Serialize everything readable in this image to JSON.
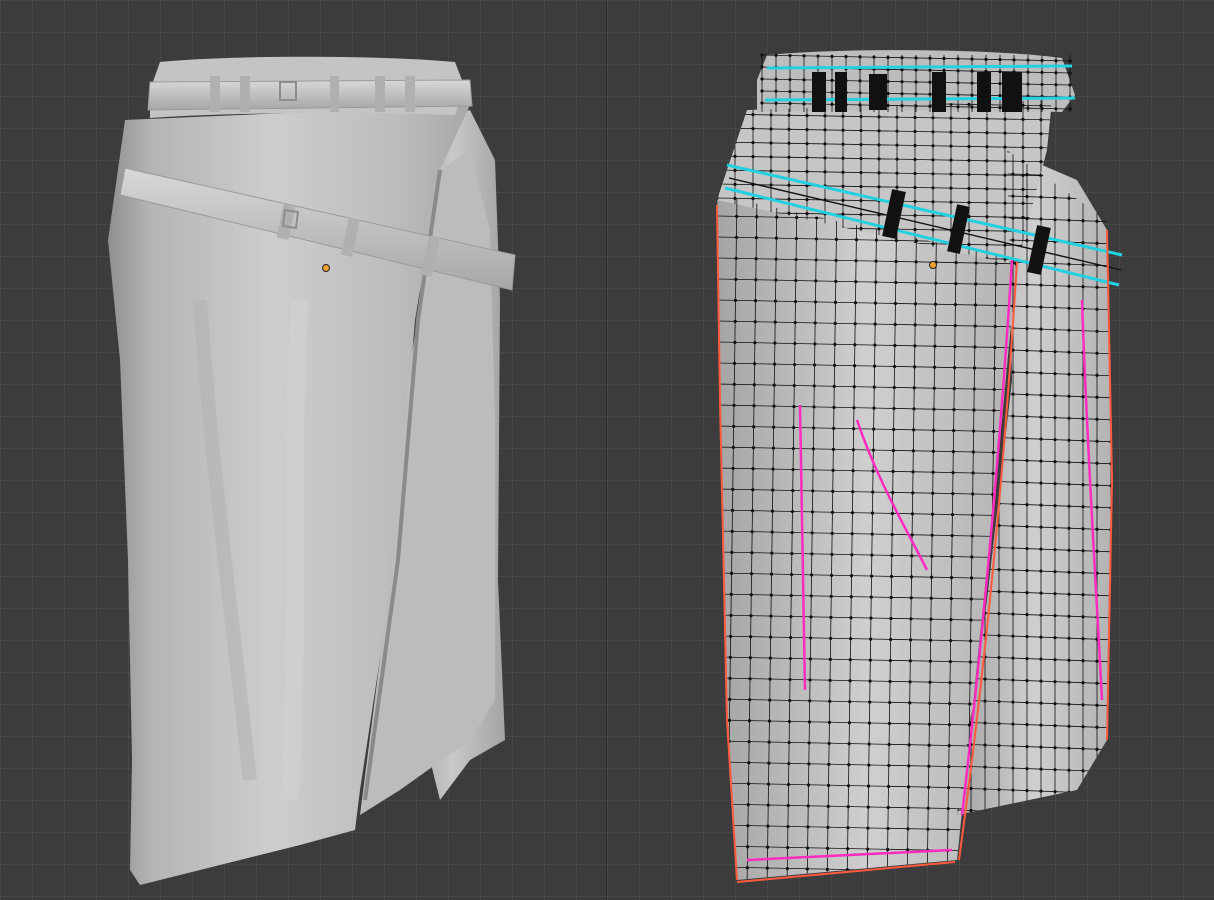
{
  "viewports": [
    {
      "id": "solid",
      "shading": "solid"
    },
    {
      "id": "wireframe",
      "shading": "wireframe-overlay"
    }
  ],
  "colors": {
    "background": "#3c3c3c",
    "mesh": "#bdbdbd",
    "origin": "#f0a030",
    "seam": "#ff2bbf",
    "sharp": "#22d0e0",
    "boundary": "#ff5a3c",
    "wire": "#111111"
  }
}
